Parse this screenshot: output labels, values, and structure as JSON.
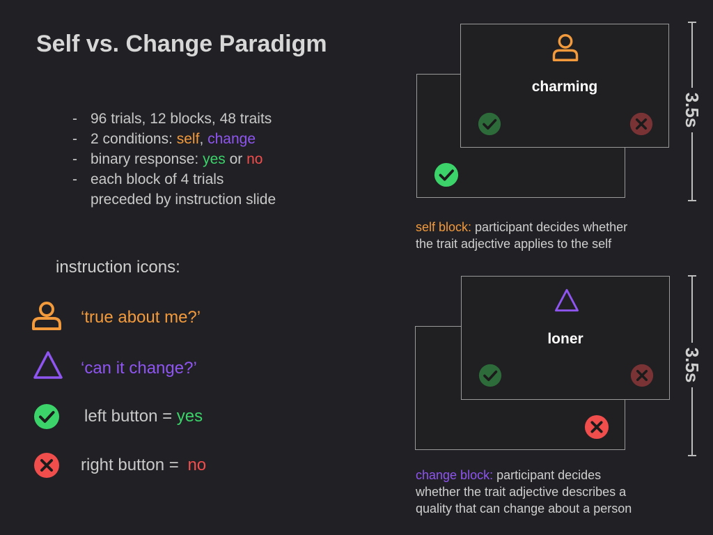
{
  "title": "Self vs. Change Paradigm",
  "bullets": [
    {
      "dash": "-",
      "text": "96 trials, 12 blocks, 48 traits"
    },
    {
      "dash": "-",
      "prefix": "2 conditions: ",
      "self": "self",
      "sep": ", ",
      "change": "change"
    },
    {
      "dash": "-",
      "prefix": "binary response: ",
      "yes": "yes",
      "sep": " or ",
      "no": "no"
    },
    {
      "dash": "-",
      "line1": "each block of 4 trials",
      "line2": "preceded by instruction slide"
    }
  ],
  "instruction_icons": {
    "heading": "instruction icons:",
    "self_prompt": "‘true about me?’",
    "change_prompt": "‘can it change?’",
    "left_label": "left button = ",
    "left_value": "yes",
    "right_label": "right button = ",
    "right_value": "no"
  },
  "self_block": {
    "word": "charming",
    "timing": "3.5s",
    "caption_label": "self block:",
    "caption_line1": " participant decides whether",
    "caption_line2": "the trait adjective applies to the self"
  },
  "change_block": {
    "word": "loner",
    "timing": "3.5s",
    "caption_label": "change block:",
    "caption_line1": " participant decides",
    "caption_line2": "whether the trait adjective describes a",
    "caption_line3": "quality that can change about a person"
  },
  "colors": {
    "background": "#212024",
    "self_orange": "#f29a3c",
    "change_purple": "#8e55f0",
    "yes_green": "#3bd36a",
    "no_red": "#f04d4d",
    "dim_green": "#2d6b3a",
    "dim_red": "#7a3335"
  },
  "icons": [
    "person-icon",
    "triangle-icon",
    "check-circle-icon",
    "x-circle-icon"
  ]
}
